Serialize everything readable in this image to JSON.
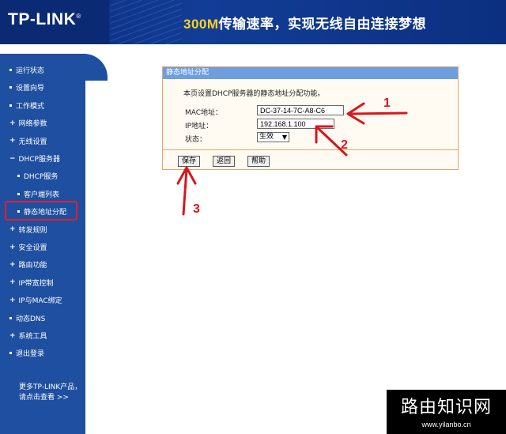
{
  "header": {
    "logo": "TP-LINK",
    "logo_mark": "®",
    "slogan_accent": "300M",
    "slogan": "传输速率，实现无线自由连接梦想"
  },
  "sidebar": {
    "items": [
      {
        "label": "运行状态",
        "marker": "bullet"
      },
      {
        "label": "设置向导",
        "marker": "bullet"
      },
      {
        "label": "工作模式",
        "marker": "bullet"
      },
      {
        "label": "网络参数",
        "marker": "plus"
      },
      {
        "label": "无线设置",
        "marker": "plus"
      },
      {
        "label": "DHCP服务器",
        "marker": "minus"
      },
      {
        "label": "DHCP服务",
        "marker": "bullet",
        "sub": true
      },
      {
        "label": "客户端列表",
        "marker": "bullet",
        "sub": true
      },
      {
        "label": "静态地址分配",
        "marker": "bullet",
        "sub": true,
        "selected": true
      },
      {
        "label": "转发规则",
        "marker": "plus"
      },
      {
        "label": "安全设置",
        "marker": "plus"
      },
      {
        "label": "路由功能",
        "marker": "plus"
      },
      {
        "label": "IP带宽控制",
        "marker": "plus"
      },
      {
        "label": "IP与MAC绑定",
        "marker": "plus"
      },
      {
        "label": "动态DNS",
        "marker": "bullet"
      },
      {
        "label": "系统工具",
        "marker": "plus"
      },
      {
        "label": "退出登录",
        "marker": "bullet"
      }
    ],
    "more_line1": "更多TP-LINK产品，",
    "more_line2": "请点击查看 >>"
  },
  "panel": {
    "title": "静态地址分配",
    "description": "本页设置DHCP服务器的静态地址分配功能。",
    "mac_label": "MAC地址：",
    "mac_value": "DC-37-14-7C-A8-C6",
    "ip_label": "IP地址：",
    "ip_value": "192.168.1.100",
    "status_label": "状态：",
    "status_value": "生效",
    "save_label": "保存",
    "back_label": "返回",
    "help_label": "帮助"
  },
  "annotations": {
    "n1": "1",
    "n2": "2",
    "n3": "3",
    "color": "#d8161e"
  },
  "watermark": {
    "title": "路由知识网",
    "url": "www.yilanbo.cn"
  }
}
